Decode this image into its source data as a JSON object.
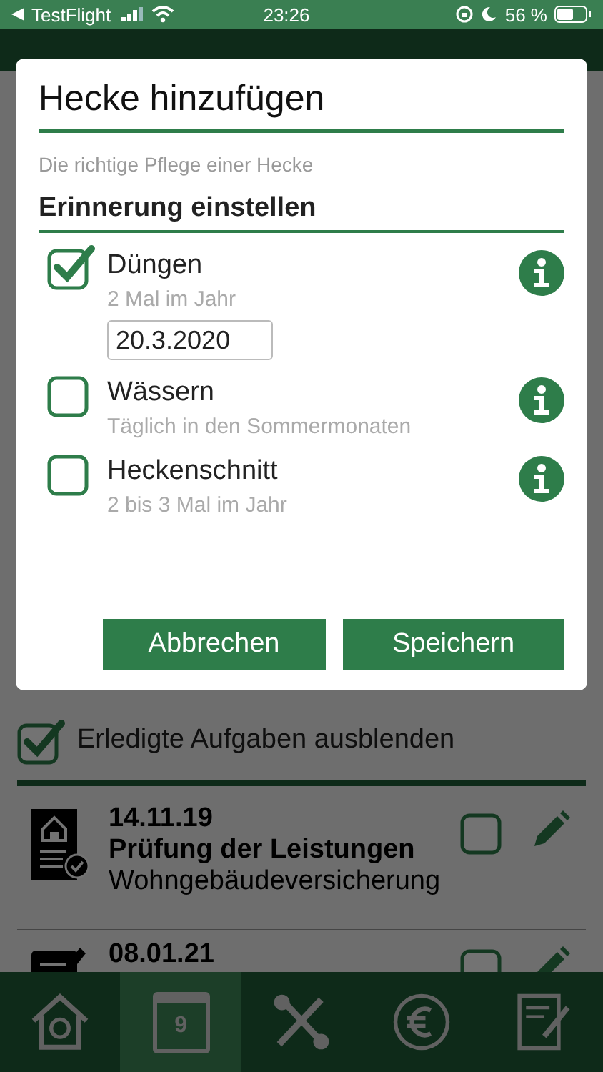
{
  "status_bar": {
    "back_label": "TestFlight",
    "time": "23:26",
    "battery": "56 %"
  },
  "hide_done": {
    "label": "Erledigte Aufgaben ausblenden",
    "checked": true
  },
  "tasks": [
    {
      "kind": "insurance",
      "date": "14.11.19",
      "title": "Prüfung der Leistungen",
      "subtitle": "Wohngebäudeversicherung",
      "checked": false
    },
    {
      "kind": "contract",
      "date": "08.01.21",
      "checked": false
    }
  ],
  "tab_bar": [
    {
      "kind": "home",
      "selected": false
    },
    {
      "kind": "calendar",
      "day": "9",
      "selected": true
    },
    {
      "kind": "tools",
      "selected": false
    },
    {
      "kind": "euro",
      "selected": false
    },
    {
      "kind": "notes",
      "selected": false
    }
  ],
  "dialog": {
    "title": "Hecke hinzufügen",
    "subtitle": "Die richtige Pflege einer Hecke",
    "section": "Erinnerung einstellen",
    "reminders": [
      {
        "label": "Düngen",
        "frequency": "2 Mal im Jahr",
        "checked": true,
        "date": "20.3.2020"
      },
      {
        "label": "Wässern",
        "frequency": "Täglich in den Sommermonaten",
        "checked": false
      },
      {
        "label": "Heckenschnitt",
        "frequency": "2 bis 3 Mal im Jahr",
        "checked": false
      }
    ],
    "buttons": [
      "Abbrechen",
      "Speichern"
    ]
  }
}
